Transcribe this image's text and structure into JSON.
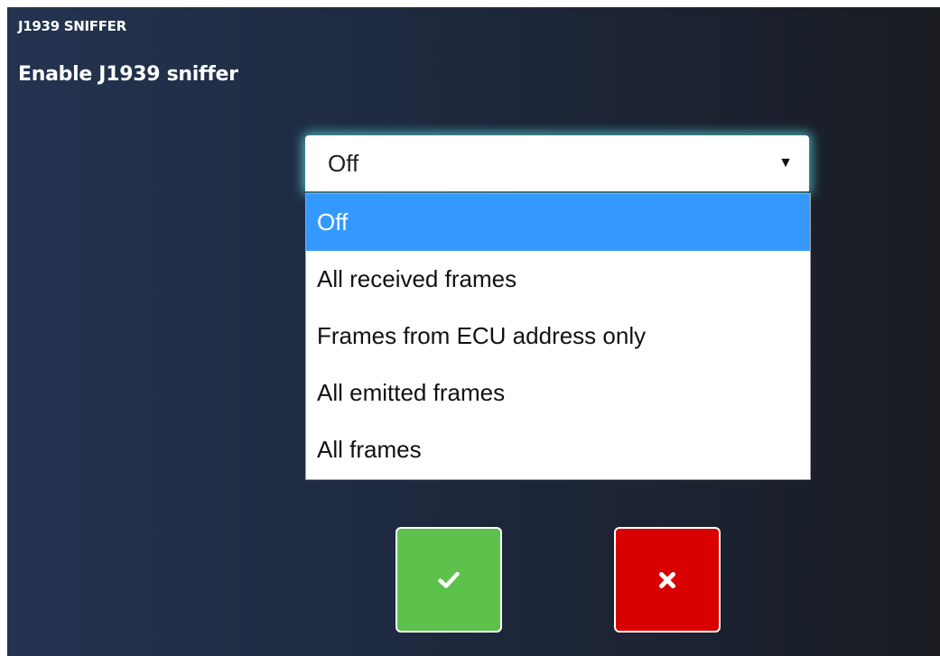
{
  "section": {
    "title": "J1939 SNIFFER"
  },
  "setting": {
    "label": "Enable J1939 sniffer",
    "selected_value": "Off",
    "options": [
      {
        "label": "Off",
        "selected": true
      },
      {
        "label": "All received frames",
        "selected": false
      },
      {
        "label": "Frames from ECU address only",
        "selected": false
      },
      {
        "label": "All emitted frames",
        "selected": false
      },
      {
        "label": "All frames",
        "selected": false
      }
    ]
  },
  "actions": {
    "confirm_icon": "checkmark-icon",
    "cancel_icon": "close-icon"
  },
  "colors": {
    "confirm": "#5cc24b",
    "cancel": "#d80000",
    "selected_option": "#3399ff",
    "focus_glow": "#5ad7dc"
  }
}
